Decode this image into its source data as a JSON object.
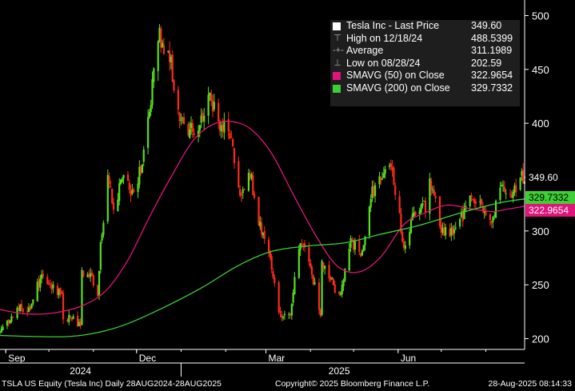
{
  "chart_data": {
    "type": "candlestick",
    "title": "TSLA US Equity (Tesla Inc)",
    "ylim": [
      190,
      510
    ],
    "y_ticks": [
      200,
      250,
      300,
      350,
      400,
      450,
      500
    ],
    "x_ticks": [
      {
        "label": "Sep",
        "date": "2024-09-01"
      },
      {
        "label": "Dec",
        "date": "2024-12-01"
      },
      {
        "label": "Mar",
        "date": "2025-03-01"
      },
      {
        "label": "Jun",
        "date": "2025-06-01"
      }
    ],
    "year_labels": [
      {
        "label": "2024",
        "date": "2024-10-23"
      },
      {
        "label": "2025",
        "date": "2025-04-21"
      }
    ],
    "x_range": [
      "2024-08-28",
      "2025-08-28"
    ],
    "up_color": "#56e01f",
    "down_color": "#ff2a1a",
    "close_series": [
      {
        "date": "2024-08-28",
        "close": 205.75
      },
      {
        "date": "2024-09-04",
        "close": 219.4
      },
      {
        "date": "2024-09-11",
        "close": 229.81
      },
      {
        "date": "2024-09-18",
        "close": 227.2
      },
      {
        "date": "2024-09-25",
        "close": 257.02
      },
      {
        "date": "2024-10-02",
        "close": 249.02
      },
      {
        "date": "2024-10-09",
        "close": 241.05
      },
      {
        "date": "2024-10-10",
        "close": 238.77
      },
      {
        "date": "2024-10-11",
        "close": 217.8
      },
      {
        "date": "2024-10-16",
        "close": 221.33
      },
      {
        "date": "2024-10-23",
        "close": 213.65
      },
      {
        "date": "2024-10-24",
        "close": 260.48
      },
      {
        "date": "2024-10-30",
        "close": 257.55
      },
      {
        "date": "2024-11-04",
        "close": 242.84
      },
      {
        "date": "2024-11-06",
        "close": 288.53
      },
      {
        "date": "2024-11-11",
        "close": 350
      },
      {
        "date": "2024-11-15",
        "close": 320.72
      },
      {
        "date": "2024-11-22",
        "close": 352.56
      },
      {
        "date": "2024-11-27",
        "close": 332.89
      },
      {
        "date": "2024-12-04",
        "close": 357.09
      },
      {
        "date": "2024-12-11",
        "close": 424.77
      },
      {
        "date": "2024-12-17",
        "close": 479.86
      },
      {
        "date": "2024-12-24",
        "close": 462.28
      },
      {
        "date": "2024-12-31",
        "close": 403.84
      },
      {
        "date": "2025-01-07",
        "close": 394.36
      },
      {
        "date": "2025-01-14",
        "close": 396.36
      },
      {
        "date": "2025-01-21",
        "close": 424.07
      },
      {
        "date": "2025-01-28",
        "close": 398.09
      },
      {
        "date": "2025-02-04",
        "close": 392.21
      },
      {
        "date": "2025-02-11",
        "close": 328.5
      },
      {
        "date": "2025-02-18",
        "close": 354.11
      },
      {
        "date": "2025-02-25",
        "close": 302.8
      },
      {
        "date": "2025-03-04",
        "close": 272.04
      },
      {
        "date": "2025-03-10",
        "close": 222.15
      },
      {
        "date": "2025-03-18",
        "close": 225.31
      },
      {
        "date": "2025-03-25",
        "close": 288.14
      },
      {
        "date": "2025-04-01",
        "close": 268.46
      },
      {
        "date": "2025-04-08",
        "close": 221.86
      },
      {
        "date": "2025-04-09",
        "close": 272.2
      },
      {
        "date": "2025-04-15",
        "close": 254.11
      },
      {
        "date": "2025-04-22",
        "close": 237.97
      },
      {
        "date": "2025-04-29",
        "close": 292.03
      },
      {
        "date": "2025-05-06",
        "close": 275.35
      },
      {
        "date": "2025-05-13",
        "close": 334.07
      },
      {
        "date": "2025-05-20",
        "close": 347.72
      },
      {
        "date": "2025-05-28",
        "close": 356.9
      },
      {
        "date": "2025-06-05",
        "close": 284.7
      },
      {
        "date": "2025-06-12",
        "close": 319.11
      },
      {
        "date": "2025-06-20",
        "close": 322.16
      },
      {
        "date": "2025-06-23",
        "close": 348.68
      },
      {
        "date": "2025-07-01",
        "close": 300.71
      },
      {
        "date": "2025-07-08",
        "close": 297.81
      },
      {
        "date": "2025-07-15",
        "close": 310.78
      },
      {
        "date": "2025-07-22",
        "close": 332.11
      },
      {
        "date": "2025-07-29",
        "close": 321.2
      },
      {
        "date": "2025-08-05",
        "close": 308.72
      },
      {
        "date": "2025-08-12",
        "close": 339.03
      },
      {
        "date": "2025-08-19",
        "close": 329.31
      },
      {
        "date": "2025-08-22",
        "close": 340.01
      },
      {
        "date": "2025-08-26",
        "close": 351.67
      },
      {
        "date": "2025-08-28",
        "close": 349.6
      }
    ],
    "series": [
      {
        "name": "SMAVG (50)",
        "color": "#e0147a",
        "points": [
          {
            "date": "2024-08-28",
            "value": 227
          },
          {
            "date": "2024-09-15",
            "value": 223
          },
          {
            "date": "2024-10-05",
            "value": 224
          },
          {
            "date": "2024-10-25",
            "value": 231
          },
          {
            "date": "2024-11-10",
            "value": 245
          },
          {
            "date": "2024-11-25",
            "value": 273
          },
          {
            "date": "2024-12-10",
            "value": 313
          },
          {
            "date": "2024-12-25",
            "value": 350
          },
          {
            "date": "2025-01-10",
            "value": 385
          },
          {
            "date": "2025-01-25",
            "value": 400
          },
          {
            "date": "2025-02-08",
            "value": 401
          },
          {
            "date": "2025-02-20",
            "value": 393
          },
          {
            "date": "2025-03-05",
            "value": 372
          },
          {
            "date": "2025-03-20",
            "value": 334
          },
          {
            "date": "2025-04-05",
            "value": 295
          },
          {
            "date": "2025-04-20",
            "value": 267
          },
          {
            "date": "2025-05-05",
            "value": 262
          },
          {
            "date": "2025-05-20",
            "value": 276
          },
          {
            "date": "2025-06-05",
            "value": 306
          },
          {
            "date": "2025-06-20",
            "value": 317
          },
          {
            "date": "2025-07-05",
            "value": 324
          },
          {
            "date": "2025-07-20",
            "value": 321
          },
          {
            "date": "2025-08-05",
            "value": 318
          },
          {
            "date": "2025-08-15",
            "value": 320
          },
          {
            "date": "2025-08-28",
            "value": 322.9654
          }
        ]
      },
      {
        "name": "SMAVG (200)",
        "color": "#3ecf35",
        "points": [
          {
            "date": "2024-08-28",
            "value": 203
          },
          {
            "date": "2024-09-20",
            "value": 202
          },
          {
            "date": "2024-10-15",
            "value": 202
          },
          {
            "date": "2024-11-05",
            "value": 206
          },
          {
            "date": "2024-11-25",
            "value": 214
          },
          {
            "date": "2024-12-20",
            "value": 229
          },
          {
            "date": "2025-01-15",
            "value": 247
          },
          {
            "date": "2025-02-10",
            "value": 268
          },
          {
            "date": "2025-03-05",
            "value": 281
          },
          {
            "date": "2025-03-30",
            "value": 286
          },
          {
            "date": "2025-04-25",
            "value": 289
          },
          {
            "date": "2025-05-20",
            "value": 297
          },
          {
            "date": "2025-06-15",
            "value": 305
          },
          {
            "date": "2025-07-15",
            "value": 317
          },
          {
            "date": "2025-08-10",
            "value": 326
          },
          {
            "date": "2025-08-28",
            "value": 329.7332
          }
        ]
      }
    ]
  },
  "legend": {
    "rows": [
      {
        "icon": "square",
        "color": "#ffffff",
        "label": "Tesla Inc - Last Price",
        "value": "349.60"
      },
      {
        "icon": "high-marker-icon",
        "label": "High on 12/18/24",
        "value": "488.5399"
      },
      {
        "icon": "average-marker-icon",
        "label": "Average",
        "value": "311.1989"
      },
      {
        "icon": "low-marker-icon",
        "label": "Low on 08/28/24",
        "value": "202.59"
      },
      {
        "icon": "square",
        "color": "#e0147a",
        "label": "SMAVG (50)  on Close",
        "value": "322.9654"
      },
      {
        "icon": "square",
        "color": "#3ecf35",
        "label": "SMAVG (200)  on Close",
        "value": "329.7332"
      }
    ]
  },
  "tags": {
    "last": {
      "text": "349.60",
      "value": 349.6,
      "bg": "#000000",
      "fg": "#ffffff"
    },
    "sma200": {
      "text": "329.7332",
      "value": 329.7332,
      "bg": "#3ecf35",
      "fg": "#000000"
    },
    "sma50": {
      "text": "322.9654",
      "value": 322.9654,
      "bg": "#e0147a",
      "fg": "#ffffff"
    }
  },
  "footer": {
    "left": "TSLA US Equity (Tesla Inc)  Daily 28AUG2024-28AUG2025",
    "center": "Copyright© 2025 Bloomberg Finance L.P.",
    "right": "28-Aug-2025 08:14:33"
  }
}
